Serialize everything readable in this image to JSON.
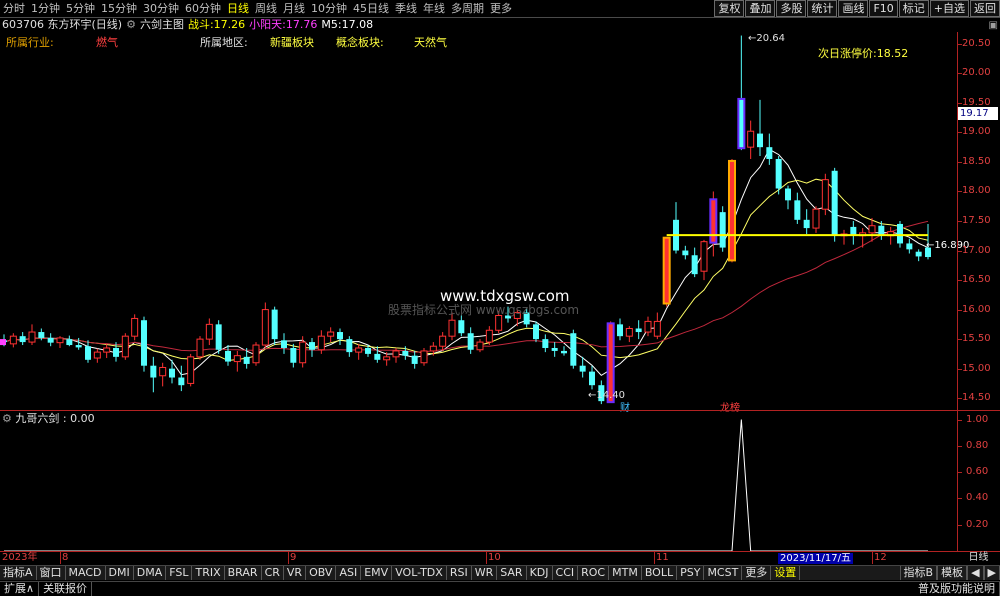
{
  "toolbar": {
    "periods": [
      "分时",
      "1分钟",
      "5分钟",
      "15分钟",
      "30分钟",
      "60分钟",
      "日线",
      "周线",
      "月线",
      "10分钟",
      "45日线",
      "季线",
      "年线",
      "多周期",
      "更多"
    ],
    "active_period": "日线",
    "right_buttons": [
      "复权",
      "叠加",
      "多股",
      "统计",
      "画线",
      "F10",
      "标记",
      "+自选",
      "返回"
    ]
  },
  "info": {
    "stock": "603706 东方环宇(日线)",
    "indicator": "六剑主图",
    "zhandou_label": "战斗:",
    "zhandou_value": "17.26",
    "xiaoyangtian_label": "小阳天:",
    "xiaoyangtian_value": "17.76",
    "m5_label": "M5:",
    "m5_value": "17.08",
    "corner": "▣"
  },
  "profile": {
    "industry_label": "所属行业:",
    "industry_value": "燃气",
    "region_label": "所属地区:",
    "region_value": "新疆板块",
    "concept_label": "概念板块:",
    "concept_value": "天然气"
  },
  "annotations": {
    "high": "20.64",
    "low": "14.40",
    "right_price": "16.890",
    "limit_label": "次日涨停价:",
    "limit_value": "18.52",
    "current_price": "19.17",
    "tag_cai": "财",
    "tag_longhu": "龙榜",
    "watermark_main": "www.tdxgsw.com",
    "watermark_sub": "股票指标公式网 www.gszbgs.com"
  },
  "price_axis": {
    "ticks": [
      "20.50",
      "20.00",
      "19.50",
      "19.00",
      "18.50",
      "18.00",
      "17.50",
      "17.00",
      "16.50",
      "16.00",
      "15.50",
      "15.00",
      "14.50"
    ]
  },
  "sub_panel": {
    "title": "九哥六剑 : 0.00",
    "ticks": [
      "1.00",
      "0.80",
      "0.60",
      "0.40",
      "0.20"
    ]
  },
  "date_axis": {
    "labels": [
      "2023年",
      "8",
      "9",
      "10",
      "11",
      "12"
    ],
    "highlight": "2023/11/17/五",
    "period_label": "日线"
  },
  "indicator_tabs": [
    "指标A",
    "窗口",
    "MACD",
    "DMI",
    "DMA",
    "FSL",
    "TRIX",
    "BRAR",
    "CR",
    "VR",
    "OBV",
    "ASI",
    "EMV",
    "VOL-TDX",
    "RSI",
    "WR",
    "SAR",
    "KDJ",
    "CCI",
    "ROC",
    "MTM",
    "BOLL",
    "PSY",
    "MCST",
    "更多",
    "设置"
  ],
  "tab_right": [
    "指标B",
    "模板",
    "◀",
    "▶"
  ],
  "status": {
    "left": [
      "扩展∧",
      "关联报价"
    ],
    "right": [
      "普及版功能说明"
    ]
  },
  "colors": {
    "up": "#ff3232",
    "down": "#54ffff",
    "ma_white": "#ffffff",
    "ma_yellow": "#ffff66",
    "ma_red": "#c0283c",
    "grid": "#b22222",
    "axis_text": "#e04040"
  },
  "chart_data": {
    "type": "candlestick",
    "ylim": [
      14.3,
      20.7
    ],
    "candles": [
      {
        "o": 15.48,
        "h": 15.58,
        "l": 15.38,
        "c": 15.45
      },
      {
        "o": 15.42,
        "h": 15.6,
        "l": 15.36,
        "c": 15.55
      },
      {
        "o": 15.55,
        "h": 15.62,
        "l": 15.4,
        "c": 15.45
      },
      {
        "o": 15.45,
        "h": 15.75,
        "l": 15.4,
        "c": 15.62
      },
      {
        "o": 15.62,
        "h": 15.68,
        "l": 15.48,
        "c": 15.52
      },
      {
        "o": 15.52,
        "h": 15.6,
        "l": 15.38,
        "c": 15.44
      },
      {
        "o": 15.44,
        "h": 15.55,
        "l": 15.35,
        "c": 15.52
      },
      {
        "o": 15.5,
        "h": 15.56,
        "l": 15.38,
        "c": 15.4
      },
      {
        "o": 15.4,
        "h": 15.52,
        "l": 15.32,
        "c": 15.36
      },
      {
        "o": 15.38,
        "h": 15.48,
        "l": 15.1,
        "c": 15.15
      },
      {
        "o": 15.18,
        "h": 15.34,
        "l": 15.1,
        "c": 15.28
      },
      {
        "o": 15.28,
        "h": 15.42,
        "l": 15.18,
        "c": 15.35
      },
      {
        "o": 15.35,
        "h": 15.45,
        "l": 15.12,
        "c": 15.2
      },
      {
        "o": 15.2,
        "h": 15.6,
        "l": 15.15,
        "c": 15.55
      },
      {
        "o": 15.55,
        "h": 15.92,
        "l": 15.48,
        "c": 15.85
      },
      {
        "o": 15.82,
        "h": 15.88,
        "l": 14.95,
        "c": 15.05
      },
      {
        "o": 15.05,
        "h": 15.2,
        "l": 14.6,
        "c": 14.85
      },
      {
        "o": 14.88,
        "h": 15.1,
        "l": 14.7,
        "c": 15.02
      },
      {
        "o": 15.0,
        "h": 15.15,
        "l": 14.75,
        "c": 14.85
      },
      {
        "o": 14.85,
        "h": 15.05,
        "l": 14.62,
        "c": 14.72
      },
      {
        "o": 14.75,
        "h": 15.25,
        "l": 14.7,
        "c": 15.2
      },
      {
        "o": 15.2,
        "h": 15.55,
        "l": 15.15,
        "c": 15.5
      },
      {
        "o": 15.5,
        "h": 15.85,
        "l": 15.4,
        "c": 15.75
      },
      {
        "o": 15.75,
        "h": 15.82,
        "l": 15.25,
        "c": 15.32
      },
      {
        "o": 15.3,
        "h": 15.4,
        "l": 15.05,
        "c": 15.12
      },
      {
        "o": 15.12,
        "h": 15.3,
        "l": 14.95,
        "c": 15.22
      },
      {
        "o": 15.2,
        "h": 15.35,
        "l": 15.0,
        "c": 15.08
      },
      {
        "o": 15.1,
        "h": 15.45,
        "l": 15.05,
        "c": 15.4
      },
      {
        "o": 15.4,
        "h": 16.12,
        "l": 15.35,
        "c": 16.0
      },
      {
        "o": 16.0,
        "h": 16.05,
        "l": 15.4,
        "c": 15.5
      },
      {
        "o": 15.48,
        "h": 15.6,
        "l": 15.25,
        "c": 15.35
      },
      {
        "o": 15.35,
        "h": 15.42,
        "l": 15.02,
        "c": 15.1
      },
      {
        "o": 15.1,
        "h": 15.55,
        "l": 15.02,
        "c": 15.45
      },
      {
        "o": 15.45,
        "h": 15.52,
        "l": 15.2,
        "c": 15.32
      },
      {
        "o": 15.32,
        "h": 15.65,
        "l": 15.25,
        "c": 15.55
      },
      {
        "o": 15.55,
        "h": 15.7,
        "l": 15.45,
        "c": 15.62
      },
      {
        "o": 15.62,
        "h": 15.68,
        "l": 15.4,
        "c": 15.5
      },
      {
        "o": 15.5,
        "h": 15.55,
        "l": 15.2,
        "c": 15.28
      },
      {
        "o": 15.28,
        "h": 15.42,
        "l": 15.15,
        "c": 15.35
      },
      {
        "o": 15.35,
        "h": 15.4,
        "l": 15.2,
        "c": 15.25
      },
      {
        "o": 15.25,
        "h": 15.38,
        "l": 15.1,
        "c": 15.15
      },
      {
        "o": 15.15,
        "h": 15.28,
        "l": 15.05,
        "c": 15.2
      },
      {
        "o": 15.2,
        "h": 15.35,
        "l": 15.1,
        "c": 15.3
      },
      {
        "o": 15.3,
        "h": 15.38,
        "l": 15.15,
        "c": 15.22
      },
      {
        "o": 15.22,
        "h": 15.3,
        "l": 15.0,
        "c": 15.08
      },
      {
        "o": 15.1,
        "h": 15.35,
        "l": 15.05,
        "c": 15.3
      },
      {
        "o": 15.3,
        "h": 15.45,
        "l": 15.22,
        "c": 15.38
      },
      {
        "o": 15.38,
        "h": 15.62,
        "l": 15.3,
        "c": 15.55
      },
      {
        "o": 15.55,
        "h": 15.95,
        "l": 15.48,
        "c": 15.82
      },
      {
        "o": 15.82,
        "h": 15.9,
        "l": 15.55,
        "c": 15.6
      },
      {
        "o": 15.6,
        "h": 15.7,
        "l": 15.25,
        "c": 15.32
      },
      {
        "o": 15.32,
        "h": 15.5,
        "l": 15.28,
        "c": 15.45
      },
      {
        "o": 15.45,
        "h": 15.72,
        "l": 15.4,
        "c": 15.65
      },
      {
        "o": 15.65,
        "h": 15.98,
        "l": 15.6,
        "c": 15.9
      },
      {
        "o": 15.9,
        "h": 16.05,
        "l": 15.78,
        "c": 15.85
      },
      {
        "o": 15.85,
        "h": 16.0,
        "l": 15.72,
        "c": 15.95
      },
      {
        "o": 15.95,
        "h": 16.02,
        "l": 15.7,
        "c": 15.75
      },
      {
        "o": 15.75,
        "h": 15.8,
        "l": 15.45,
        "c": 15.5
      },
      {
        "o": 15.5,
        "h": 15.58,
        "l": 15.28,
        "c": 15.35
      },
      {
        "o": 15.35,
        "h": 15.45,
        "l": 15.2,
        "c": 15.3
      },
      {
        "o": 15.3,
        "h": 15.38,
        "l": 15.22,
        "c": 15.26
      },
      {
        "o": 15.6,
        "h": 15.66,
        "l": 15.0,
        "c": 15.05
      },
      {
        "o": 15.05,
        "h": 15.2,
        "l": 14.85,
        "c": 14.95
      },
      {
        "o": 14.95,
        "h": 15.05,
        "l": 14.65,
        "c": 14.72
      },
      {
        "o": 14.72,
        "h": 14.8,
        "l": 14.4,
        "c": 14.45
      },
      {
        "o": 14.45,
        "h": 15.8,
        "l": 14.42,
        "c": 15.75
      },
      {
        "o": 15.75,
        "h": 15.85,
        "l": 15.48,
        "c": 15.55
      },
      {
        "o": 15.55,
        "h": 15.72,
        "l": 15.45,
        "c": 15.68
      },
      {
        "o": 15.68,
        "h": 15.82,
        "l": 15.5,
        "c": 15.62
      },
      {
        "o": 15.62,
        "h": 15.88,
        "l": 15.55,
        "c": 15.8
      },
      {
        "o": 15.55,
        "h": 15.95,
        "l": 15.5,
        "c": 15.8
      },
      {
        "o": 16.12,
        "h": 17.22,
        "l": 16.05,
        "c": 17.2
      },
      {
        "o": 17.52,
        "h": 17.82,
        "l": 16.95,
        "c": 17.0
      },
      {
        "o": 17.0,
        "h": 17.08,
        "l": 16.85,
        "c": 16.92
      },
      {
        "o": 16.92,
        "h": 17.05,
        "l": 16.55,
        "c": 16.6
      },
      {
        "o": 16.65,
        "h": 17.18,
        "l": 16.5,
        "c": 17.15
      },
      {
        "o": 17.15,
        "h": 18.0,
        "l": 16.9,
        "c": 17.85
      },
      {
        "o": 17.65,
        "h": 17.75,
        "l": 16.98,
        "c": 17.05
      },
      {
        "o": 16.85,
        "h": 18.55,
        "l": 16.8,
        "c": 18.5
      },
      {
        "o": 19.55,
        "h": 20.64,
        "l": 18.7,
        "c": 18.75
      },
      {
        "o": 18.75,
        "h": 19.2,
        "l": 18.55,
        "c": 19.02
      },
      {
        "o": 18.98,
        "h": 19.55,
        "l": 18.6,
        "c": 18.75
      },
      {
        "o": 18.75,
        "h": 18.98,
        "l": 18.45,
        "c": 18.55
      },
      {
        "o": 18.55,
        "h": 18.6,
        "l": 17.95,
        "c": 18.05
      },
      {
        "o": 18.05,
        "h": 18.1,
        "l": 17.7,
        "c": 17.85
      },
      {
        "o": 17.85,
        "h": 17.98,
        "l": 17.45,
        "c": 17.52
      },
      {
        "o": 17.52,
        "h": 17.7,
        "l": 17.28,
        "c": 17.38
      },
      {
        "o": 17.38,
        "h": 17.75,
        "l": 17.3,
        "c": 17.7
      },
      {
        "o": 17.7,
        "h": 18.3,
        "l": 17.6,
        "c": 18.2
      },
      {
        "o": 18.35,
        "h": 18.4,
        "l": 17.15,
        "c": 17.25
      },
      {
        "o": 17.25,
        "h": 17.35,
        "l": 17.1,
        "c": 17.28
      },
      {
        "o": 17.4,
        "h": 17.5,
        "l": 17.1,
        "c": 17.25
      },
      {
        "o": 17.25,
        "h": 17.38,
        "l": 17.05,
        "c": 17.3
      },
      {
        "o": 17.3,
        "h": 17.55,
        "l": 17.15,
        "c": 17.42
      },
      {
        "o": 17.42,
        "h": 17.5,
        "l": 17.18,
        "c": 17.25
      },
      {
        "o": 17.25,
        "h": 17.4,
        "l": 17.1,
        "c": 17.32
      },
      {
        "o": 17.45,
        "h": 17.5,
        "l": 17.05,
        "c": 17.12
      },
      {
        "o": 17.12,
        "h": 17.2,
        "l": 16.95,
        "c": 17.02
      },
      {
        "o": 16.98,
        "h": 17.02,
        "l": 16.82,
        "c": 16.9
      },
      {
        "o": 17.05,
        "h": 17.45,
        "l": 16.85,
        "c": 16.89
      }
    ],
    "thick_bars": [
      {
        "index": 65,
        "color": "#6a2cff"
      },
      {
        "index": 71,
        "color": "#ffaa00"
      },
      {
        "index": 76,
        "color": "#6a2cff"
      },
      {
        "index": 78,
        "color": "#ffaa00"
      },
      {
        "index": 79,
        "color": "#6a2cff"
      }
    ],
    "horizontal_line": {
      "value": 17.26,
      "from_index": 71,
      "color": "#ffff00"
    },
    "signal": {
      "peak_index": 79,
      "value": 1.0,
      "ylim": [
        0,
        1.05
      ]
    }
  }
}
